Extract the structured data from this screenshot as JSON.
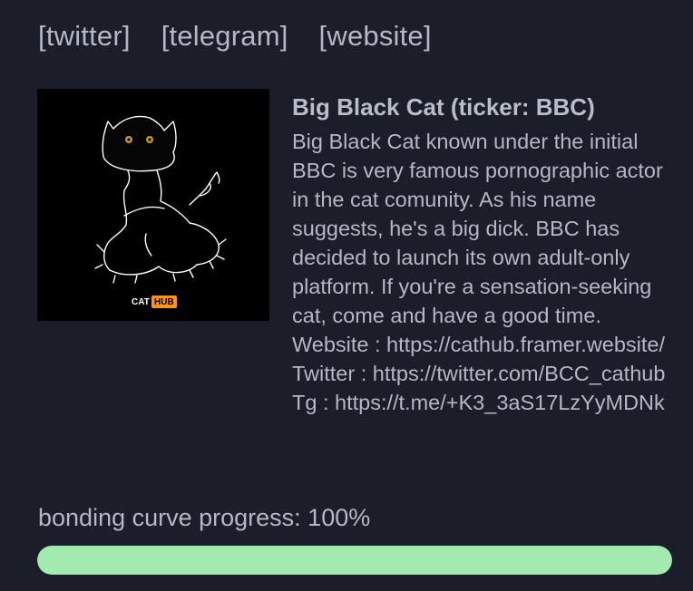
{
  "links": {
    "twitter": "[twitter]",
    "telegram": "[telegram]",
    "website": "[website]"
  },
  "token": {
    "image_logo_text": "CAT",
    "image_logo_badge": "HUB",
    "title": "Big Black Cat (ticker: BBC)",
    "description": "Big Black Cat known under the initial BBC is very famous pornographic actor in the cat comunity. As his name suggests, he's a big dick. BBC has decided to launch its own adult-only platform. If you're a sensation-seeking cat, come and have a good time. Website : https://cathub.framer.website/ Twitter : https://twitter.com/BCC_cathub Tg : https://t.me/+K3_3aS17LzYyMDNk"
  },
  "progress": {
    "label": "bonding curve progress: 100%",
    "percent": 100
  },
  "colors": {
    "background": "#1b1d28",
    "text": "#b3b8c6",
    "progress_fill": "#a2ebb0",
    "logo_badge": "#f7931e"
  }
}
